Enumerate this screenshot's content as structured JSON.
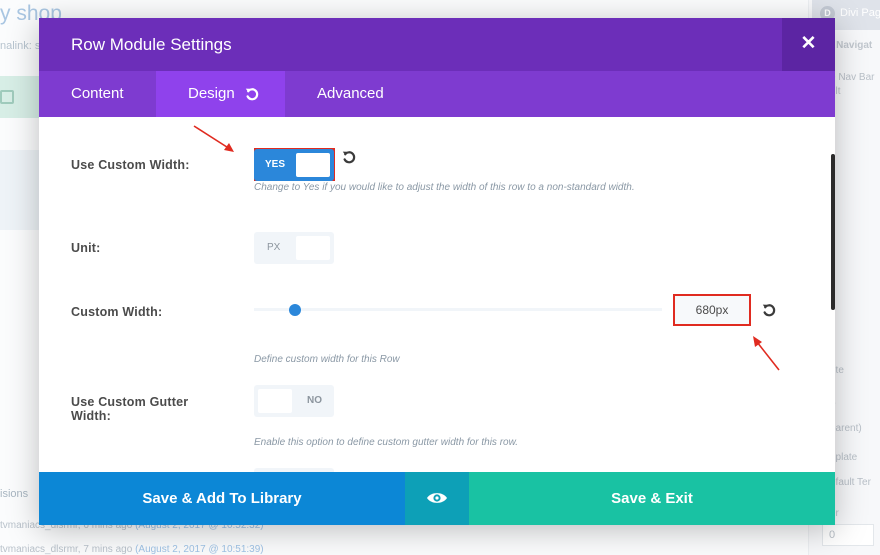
{
  "background": {
    "title": "y shop",
    "permalink": "nalink: s",
    "revisions_heading": "isions",
    "revisions": [
      {
        "text": "tvmaniacs_dlsrmr, 6 mins ago ",
        "link": "(August 2, 2017 @ 10:52:32)"
      },
      {
        "text": "tvmaniacs_dlsrmr, 7 mins ago ",
        "link": "(August 2, 2017 @ 10:51:39)"
      }
    ],
    "right_panel": {
      "header": "Divi Page",
      "header_icon": "D",
      "items": [
        "t Navigat",
        "e Nav Bar",
        "ult",
        "lt",
        "ute",
        "o",
        "parent)",
        "nplate",
        "efault Ter",
        "er"
      ],
      "input_value": "0"
    }
  },
  "modal": {
    "title": "Row Module Settings",
    "close_icon": "close-icon",
    "tabs": [
      {
        "label": "Content"
      },
      {
        "label": "Design",
        "active": true
      },
      {
        "label": "Advanced"
      }
    ],
    "fields": {
      "custom_width": {
        "label": "Use Custom Width:",
        "toggle": "YES",
        "description": "Change to Yes if you would like to adjust the width of this row to a non-standard width."
      },
      "unit": {
        "label": "Unit:",
        "toggle": "PX"
      },
      "custom_width_value": {
        "label": "Custom Width:",
        "value": "680px",
        "slider_fraction": 0.1,
        "description": "Define custom width for this Row"
      },
      "gutter": {
        "label": "Use Custom Gutter Width:",
        "toggle": "NO",
        "description": "Enable this option to define custom gutter width for this row."
      }
    },
    "footer": {
      "save_library": "Save & Add To Library",
      "preview_icon": "eye-icon",
      "save_exit": "Save & Exit"
    }
  },
  "colors": {
    "header": "#6c2eb9",
    "tabs": "#7e3bd0",
    "active_tab": "#8f42ec",
    "accent_blue": "#2b87da",
    "save_library": "#0c87d6",
    "preview": "#0da0b7",
    "save_exit": "#19c2a3",
    "annotation_red": "#e02b20"
  }
}
